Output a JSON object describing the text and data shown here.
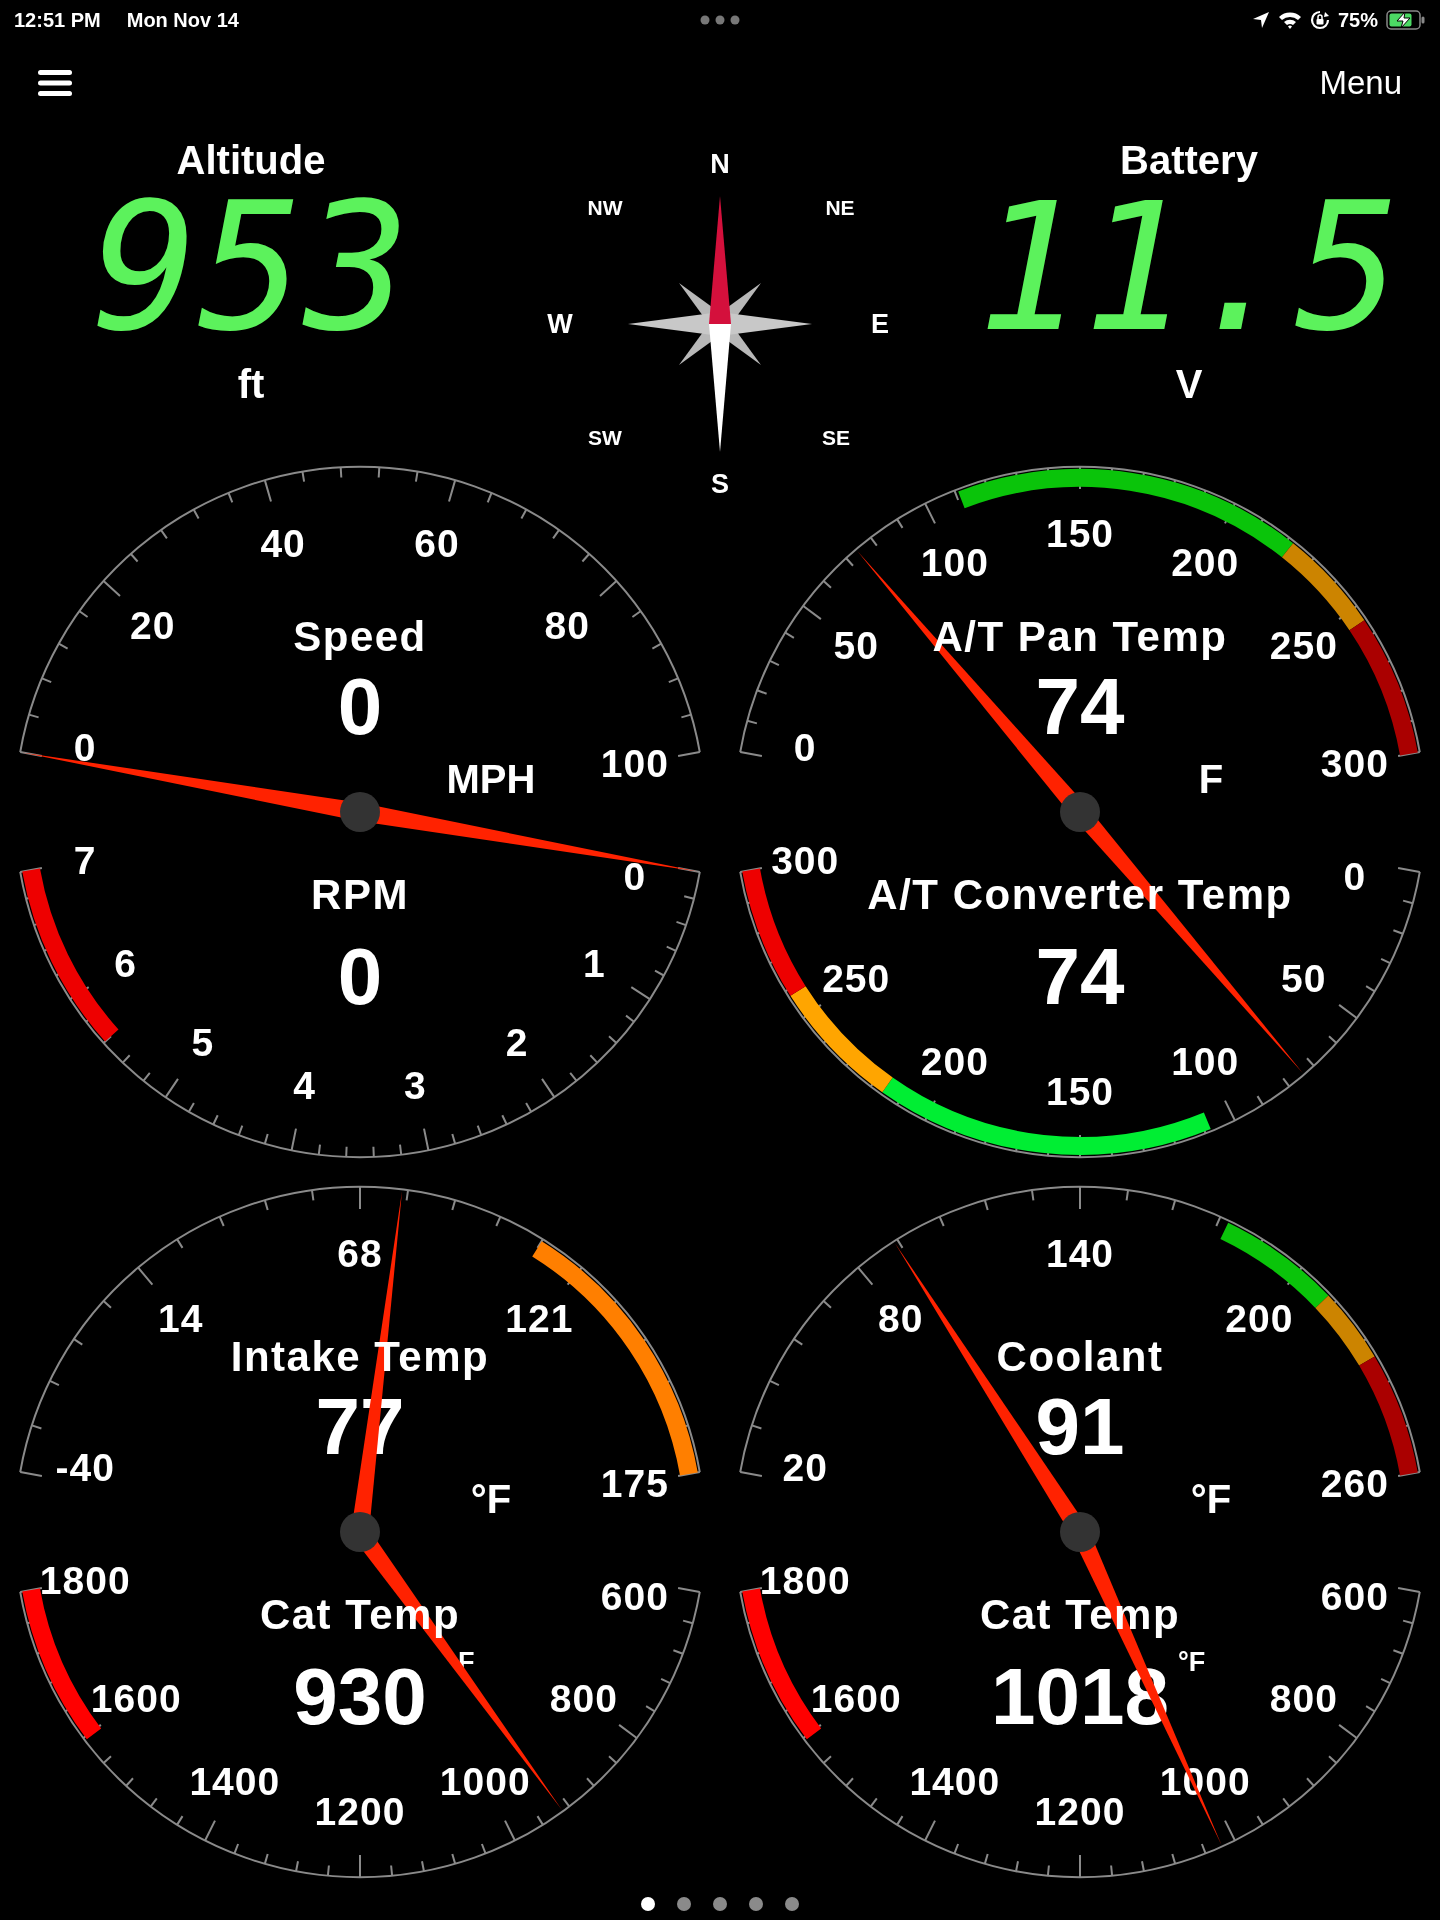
{
  "status_bar": {
    "time": "12:51 PM",
    "date": "Mon Nov 14",
    "battery": "75%"
  },
  "toolbar": {
    "menu_button": "Menu"
  },
  "readouts": [
    {
      "label": "Altitude",
      "value": "953",
      "unit": "ft"
    },
    {
      "label": "Battery",
      "value": "11.5",
      "unit": "V"
    }
  ],
  "compass": {
    "points": [
      "N",
      "NE",
      "E",
      "SE",
      "S",
      "SW",
      "W",
      "NW"
    ]
  },
  "dials": [
    {
      "upper": {
        "title": "Speed",
        "value": "0",
        "unit": "MPH",
        "scale": [
          "0",
          "20",
          "40",
          "60",
          "80",
          "100"
        ]
      },
      "lower": {
        "title": "RPM",
        "value": "0",
        "scale": [
          "0",
          "1",
          "2",
          "3",
          "4",
          "5",
          "6",
          "7"
        ],
        "zones": [
          {
            "color": "#ee0000"
          }
        ]
      }
    },
    {
      "upper": {
        "title": "A/T Pan Temp",
        "value": "74",
        "unit": "F",
        "scale": [
          "0",
          "50",
          "100",
          "150",
          "200",
          "250",
          "300"
        ],
        "zones": [
          {
            "color": "#0ac40a"
          },
          {
            "color": "#cc8400"
          },
          {
            "color": "#aa0000"
          }
        ]
      },
      "lower": {
        "title": "A/T Converter Temp",
        "value": "74",
        "scale": [
          "0",
          "50",
          "100",
          "150",
          "200",
          "250",
          "300"
        ],
        "zones": [
          {
            "color": "#00ee33"
          },
          {
            "color": "#ffa500"
          },
          {
            "color": "#ee0000"
          }
        ]
      }
    },
    {
      "upper": {
        "title": "Intake Temp",
        "value": "77",
        "unit": "°F",
        "scale": [
          "-40",
          "14",
          "68",
          "121",
          "175"
        ],
        "zones": [
          {
            "color": "#ff7f00"
          }
        ]
      },
      "lower": {
        "title": "Cat Temp",
        "value": "930",
        "unit": "F",
        "scale": [
          "600",
          "800",
          "1000",
          "1200",
          "1400",
          "1600",
          "1800"
        ],
        "zones": [
          {
            "color": "#ff0000"
          }
        ]
      }
    },
    {
      "upper": {
        "title": "Coolant",
        "value": "91",
        "unit": "°F",
        "scale": [
          "20",
          "80",
          "140",
          "200",
          "260"
        ],
        "zones": [
          {
            "color": "#0ac40a"
          },
          {
            "color": "#cc8400"
          },
          {
            "color": "#aa0000"
          }
        ]
      },
      "lower": {
        "title": "Cat Temp",
        "value": "1018",
        "unit": "°F",
        "scale": [
          "600",
          "800",
          "1000",
          "1200",
          "1400",
          "1600",
          "1800"
        ],
        "zones": [
          {
            "color": "#ff0000"
          }
        ]
      }
    }
  ],
  "page_dots": [
    {
      "selected": true
    },
    {
      "selected": false
    },
    {
      "selected": false
    },
    {
      "selected": false
    },
    {
      "selected": false
    }
  ]
}
